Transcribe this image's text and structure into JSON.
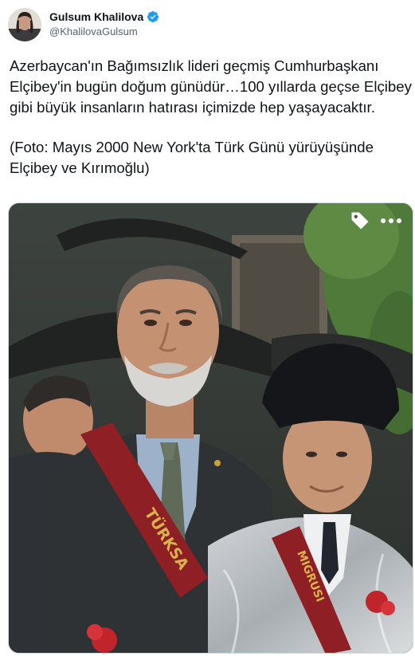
{
  "user": {
    "display_name": "Gulsum Khalilova",
    "handle": "@KhalilovaGulsum",
    "verified": true
  },
  "tweet": {
    "paragraph_1": "Azerbaycan'ın Bağımsızlık lideri geçmiş Cumhurbaşkanı Elçibey'in bugün doğum günüdür…100 yıllarda geçse Elçibey gibi büyük insanların hatırası içimizde hep yaşayacaktır.",
    "paragraph_2": "(Foto: Mayıs 2000 New York'ta Türk Günü yürüyüşünde Elçibey ve Kırımoğlu)"
  },
  "media": {
    "sash_text_left": "TÜRKSA",
    "sash_text_right": "MIGRUSI"
  },
  "icons": {
    "verified": "verified-badge-icon",
    "tag": "tag-icon",
    "more": "more-dots-icon"
  },
  "colors": {
    "verified_blue": "#1d9bf0",
    "text_primary": "#0f1419",
    "text_secondary": "#536471",
    "sash_red": "#8e1f24"
  }
}
